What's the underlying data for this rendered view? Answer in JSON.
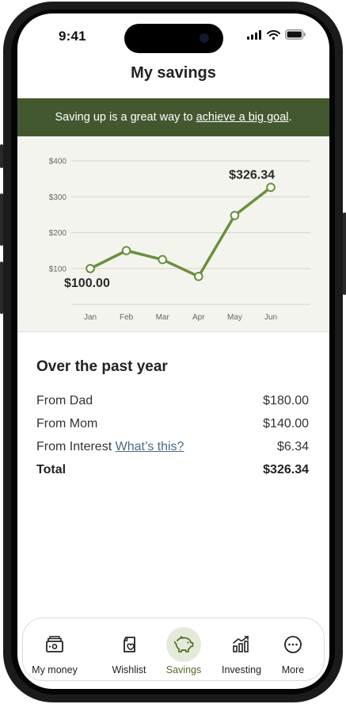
{
  "status_bar": {
    "time": "9:41"
  },
  "header": {
    "title": "My savings"
  },
  "banner": {
    "text_before": "Saving up is a great way to ",
    "link_text": "achieve a big goal",
    "text_after": "."
  },
  "colors": {
    "accent": "#6b8f3c",
    "banner_bg": "#44582f",
    "chart_bg": "#f4f4ef"
  },
  "chart_data": {
    "type": "line",
    "categories": [
      "Jan",
      "Feb",
      "Mar",
      "Apr",
      "May",
      "Jun"
    ],
    "values": [
      100,
      150,
      125,
      78,
      248,
      326.34
    ],
    "ylim": [
      0,
      400
    ],
    "yticks": [
      100,
      200,
      300,
      400
    ],
    "ytick_labels": [
      "$100",
      "$200",
      "$300",
      "$400"
    ],
    "annotations": [
      {
        "index": 0,
        "text": "$100.00"
      },
      {
        "index": 5,
        "text": "$326.34"
      }
    ],
    "grid": true,
    "title": "",
    "xlabel": "",
    "ylabel": ""
  },
  "summary": {
    "title": "Over the past year",
    "rows": [
      {
        "label": "From Dad",
        "value": "$180.00"
      },
      {
        "label": "From Mom",
        "value": "$140.00"
      },
      {
        "label": "From Interest",
        "link": "What’s this?",
        "value": "$6.34"
      }
    ],
    "total": {
      "label": "Total",
      "value": "$326.34"
    }
  },
  "tabs": [
    {
      "label": "My money",
      "icon": "wallet-icon",
      "active": false
    },
    {
      "label": "Wishlist",
      "icon": "wishlist-icon",
      "active": false
    },
    {
      "label": "Savings",
      "icon": "piggy-bank-icon",
      "active": true
    },
    {
      "label": "Investing",
      "icon": "chart-bars-icon",
      "active": false
    },
    {
      "label": "More",
      "icon": "more-icon",
      "active": false
    }
  ]
}
